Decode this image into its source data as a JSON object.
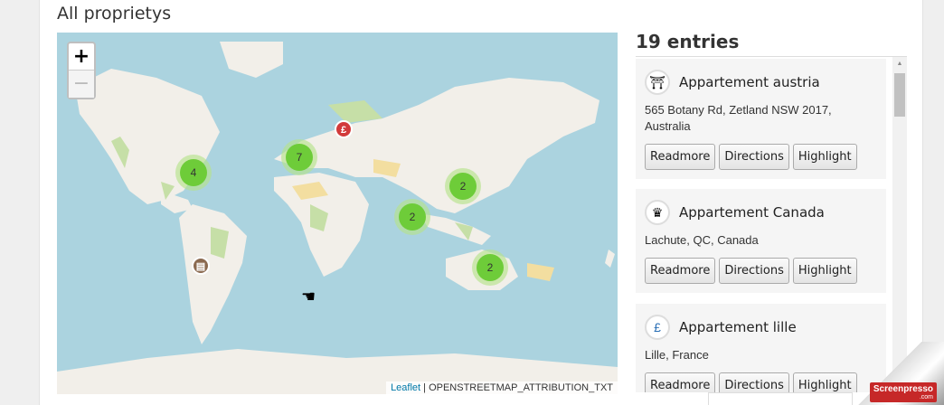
{
  "page": {
    "title": "All proprietys"
  },
  "map": {
    "zoom_in": "+",
    "zoom_out": "−",
    "clusters": [
      {
        "count": "4",
        "name": "cluster-north-america"
      },
      {
        "count": "7",
        "name": "cluster-europe"
      },
      {
        "count": "2",
        "name": "cluster-east-asia"
      },
      {
        "count": "2",
        "name": "cluster-southeast-asia"
      },
      {
        "count": "2",
        "name": "cluster-australia"
      }
    ],
    "pins": [
      {
        "icon": "pound-icon",
        "glyph": "£"
      },
      {
        "icon": "book-icon",
        "glyph": "▤"
      }
    ],
    "attribution": {
      "link": "Leaflet",
      "text": "| OPENSTREETMAP_ATTRIBUTION_TXT"
    }
  },
  "entries": {
    "title": "19 entries",
    "items": [
      {
        "title": "Appartement austria",
        "address": "565 Botany Rd, Zetland NSW 2017, Australia",
        "icon": "pagoda-icon",
        "glyph": "⛩"
      },
      {
        "title": "Appartement Canada",
        "address": "Lachute, QC, Canada",
        "icon": "crown-icon",
        "glyph": "♛"
      },
      {
        "title": "Appartement lille",
        "address": "Lille, France",
        "icon": "pound-icon",
        "glyph": "£"
      }
    ],
    "buttons": {
      "readmore": "Readmore",
      "directions": "Directions",
      "highlight": "Highlight"
    }
  },
  "watermark": {
    "brand": "Screenpresso",
    "domain": ".com"
  },
  "colors": {
    "water": "#abd3df",
    "land": "#f2efe9",
    "cluster": "#6ecc39"
  }
}
